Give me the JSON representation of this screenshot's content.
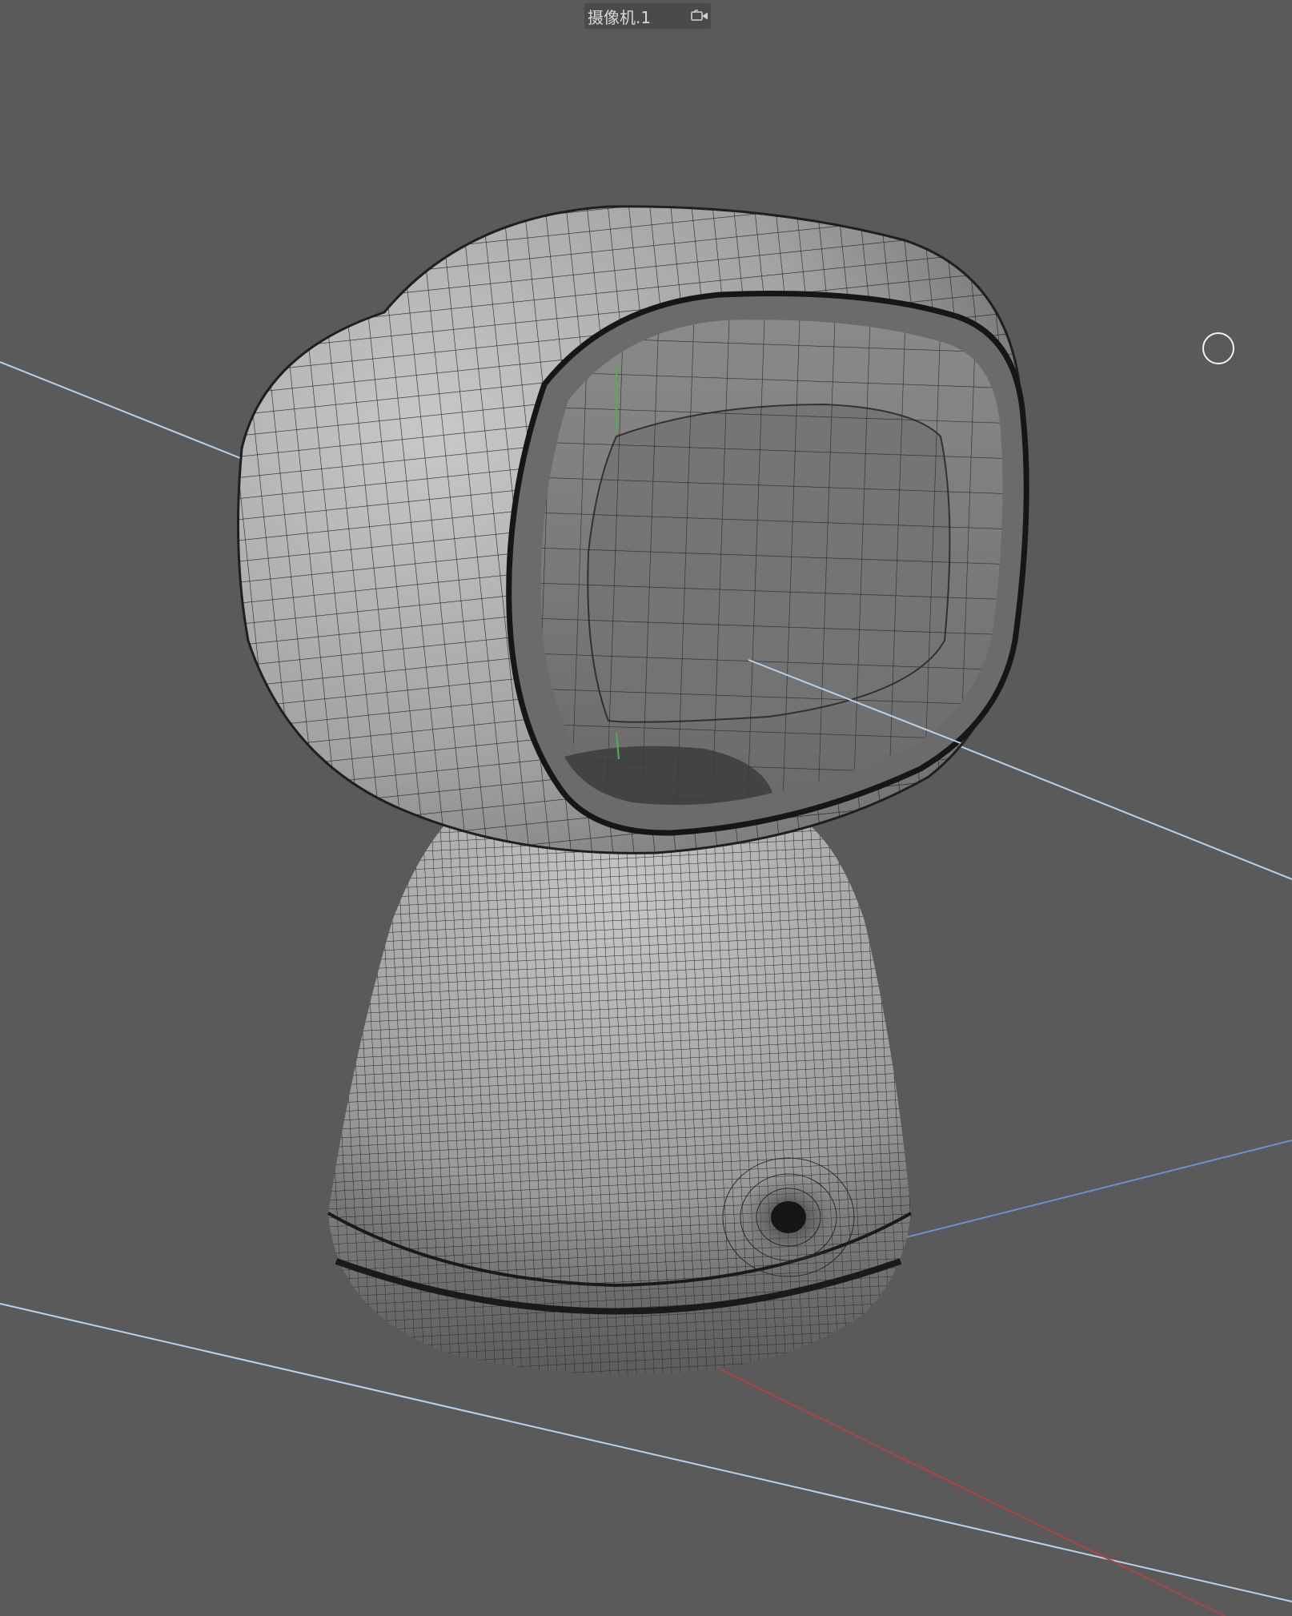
{
  "viewport": {
    "camera_name": "摄像机.1",
    "camera_icon": "video-camera-icon"
  },
  "colors": {
    "background": "#5a5a5a",
    "mesh_shade_light": "#bdbdbd",
    "mesh_shade_dark": "#5f5f5f",
    "wire": "#222222",
    "guide_line": "#b9d3ee",
    "axis_x": "#b04444",
    "axis_z": "#6c8fd6",
    "axis_y": "#4fb04f"
  }
}
